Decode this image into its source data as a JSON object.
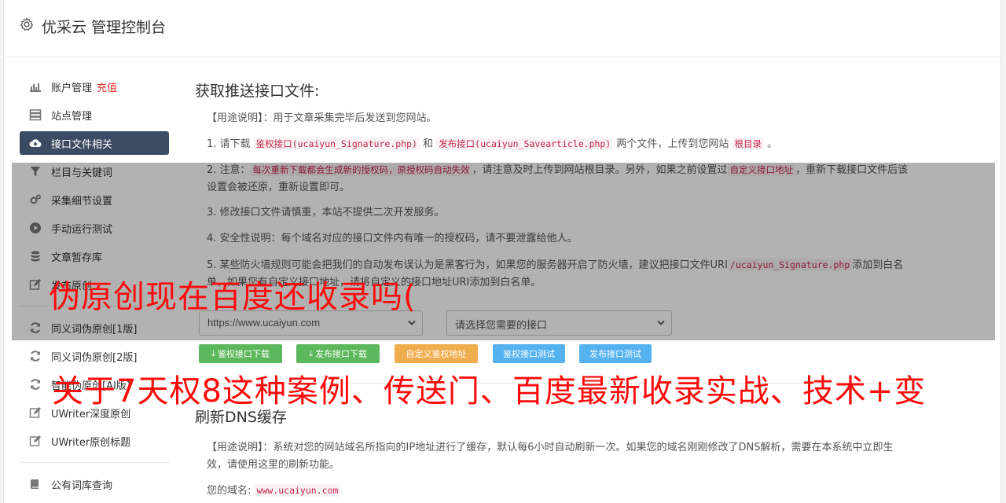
{
  "header": {
    "title": "优采云 管理控制台",
    "icon": "gear-icon"
  },
  "sidebar": {
    "items": [
      {
        "label": "账户管理",
        "badge": "充值",
        "icon": "bar-chart-icon"
      },
      {
        "label": "站点管理",
        "icon": "server-icon"
      },
      {
        "label": "接口文件相关",
        "icon": "cloud-upload-icon",
        "active": true
      },
      {
        "label": "栏目与关键词",
        "icon": "filter-icon"
      },
      {
        "label": "采集细节设置",
        "icon": "cogs-icon"
      },
      {
        "label": "手动运行测试",
        "icon": "play-circle-icon"
      },
      {
        "label": "文章暂存库",
        "icon": "database-icon"
      },
      {
        "label": "发布原创",
        "icon": "edit-icon"
      }
    ],
    "items2": [
      {
        "label": "同义词伪原创[1版]",
        "icon": "refresh-icon"
      },
      {
        "label": "同义词伪原创[2版]",
        "icon": "refresh-icon"
      },
      {
        "label": "智能伪原创[AI版]",
        "icon": "refresh-icon"
      },
      {
        "label": "UWriter深度原创",
        "icon": "edit-icon"
      },
      {
        "label": "UWriter原创标题",
        "icon": "edit-icon"
      }
    ],
    "items3": [
      {
        "label": "公有词库查询",
        "icon": "book-icon"
      }
    ]
  },
  "section1": {
    "title": "获取推送接口文件:",
    "usage_label": "【用途说明】",
    "usage_text": "：用于文章采集完毕后发送到您网站。",
    "step1": {
      "prefix": "1. 请下载 ",
      "code1": "鉴权接口(ucaiyun_Signature.php)",
      "mid": " 和 ",
      "code2": "发布接口(ucaiyun_Savearticle.php)",
      "mid2": " 两个文件，上传到您网站 ",
      "code3": "根目录",
      "suffix": " 。"
    },
    "step2": {
      "prefix": "2. 注意：",
      "code1": "每次重新下载都会生成新的授权码，原授权码自动失效",
      "mid": "，请注意及时上传到网站根目录。另外，如果之前设置过",
      "code2": "自定义接口地址",
      "suffix": "，重新下载接口文件后该设置会被还原，重新设置即可。"
    },
    "step3": "3. 修改接口文件请慎重，本站不提供二次开发服务。",
    "step4": "4. 安全性说明：每个域名对应的接口文件内有唯一的授权码，请不要泄露给他人。",
    "step5": {
      "prefix": "5. 某些防火墙规则可能会把我们的自动发布误认为是黑客行为，如果您的服务器开启了防火墙，建议把接口文件URI",
      "code1": "/ucaiyun_Signature.php",
      "suffix": "添加到白名单，如果您有自定义接口地址，请将自定义的接口地址URI添加到白名单。"
    },
    "site_select": "https://www.ucaiyun.com",
    "api_select_placeholder": "请选择您需要的接口",
    "buttons": {
      "download_sig": "鉴权接口下载",
      "download_pub": "发布接口下载",
      "custom_sig": "自定义鉴权地址",
      "test_sig": "鉴权接口测试",
      "test_pub": "发布接口测试"
    }
  },
  "section2": {
    "title": "刷新DNS缓存",
    "usage_label": "【用途说明】",
    "usage_text": "：系统对您的网站域名所指向的IP地址进行了缓存，默认每6小时自动刷新一次。如果您的域名刚刚修改了DNS解析，需要在本系统中立即生效，请使用这里的刷新功能。",
    "domain_label": "您的域名:",
    "domain_value": "www.ucaiyun.com"
  },
  "overlay_text": {
    "line1": "伪原创现在百度还收录吗(",
    "line2": "关于7天权8这种案例、传送门、百度最新收录实战、技术+变"
  },
  "colors": {
    "active_nav": "#3a4b63",
    "recharge": "#e03030",
    "btn_green": "#5cb85c",
    "btn_orange": "#f0ad4e",
    "btn_blue": "#5bc0de",
    "promo_text": "#ff0a0a",
    "code_text": "#c7254e"
  }
}
